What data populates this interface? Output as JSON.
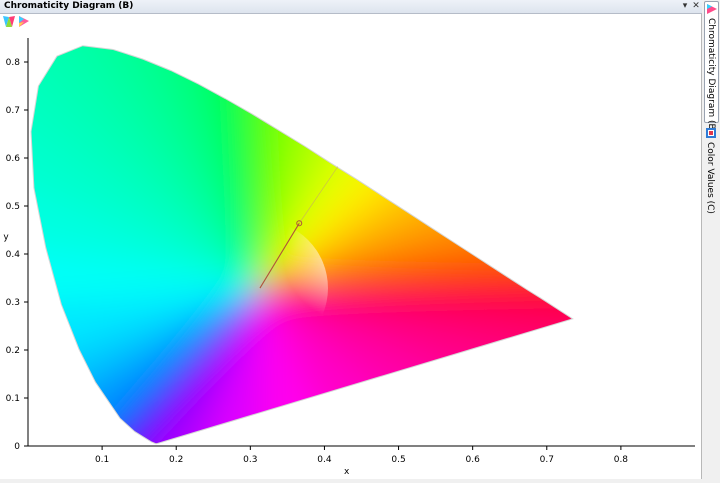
{
  "panel": {
    "title": "Chromaticity Diagram (B)"
  },
  "window_buttons": {
    "dropdown": "▾",
    "close": "✕"
  },
  "side_tabs": [
    {
      "label": "Chromaticity Diagram (B)",
      "icon": "chromaticity-icon",
      "active": true
    },
    {
      "label": "Color Values (C)",
      "icon": "color-values-icon",
      "active": false
    }
  ],
  "toolbar": {
    "icons": [
      "chromaticity-view-icon",
      "gamut-view-icon"
    ]
  },
  "chart_data": {
    "type": "scatter",
    "xlabel": "x",
    "ylabel": "y",
    "xlim": [
      0,
      0.9
    ],
    "ylim": [
      0,
      0.85
    ],
    "x_ticks": [
      "0.1",
      "0.2",
      "0.3",
      "0.4",
      "0.5",
      "0.6",
      "0.7",
      "0.8"
    ],
    "y_ticks": [
      "0",
      "0.1",
      "0.2",
      "0.3",
      "0.4",
      "0.5",
      "0.6",
      "0.7",
      "0.8"
    ],
    "spectral_locus": [
      [
        0.174,
        0.005
      ],
      [
        0.172,
        0.005
      ],
      [
        0.166,
        0.009
      ],
      [
        0.144,
        0.03
      ],
      [
        0.124,
        0.058
      ],
      [
        0.091,
        0.133
      ],
      [
        0.069,
        0.201
      ],
      [
        0.045,
        0.295
      ],
      [
        0.024,
        0.413
      ],
      [
        0.008,
        0.538
      ],
      [
        0.004,
        0.655
      ],
      [
        0.014,
        0.75
      ],
      [
        0.039,
        0.812
      ],
      [
        0.074,
        0.834
      ],
      [
        0.115,
        0.826
      ],
      [
        0.155,
        0.806
      ],
      [
        0.193,
        0.782
      ],
      [
        0.23,
        0.754
      ],
      [
        0.266,
        0.724
      ],
      [
        0.302,
        0.692
      ],
      [
        0.337,
        0.659
      ],
      [
        0.373,
        0.625
      ],
      [
        0.408,
        0.59
      ],
      [
        0.444,
        0.555
      ],
      [
        0.479,
        0.52
      ],
      [
        0.513,
        0.486
      ],
      [
        0.546,
        0.453
      ],
      [
        0.575,
        0.424
      ],
      [
        0.6,
        0.399
      ],
      [
        0.621,
        0.378
      ],
      [
        0.638,
        0.361
      ],
      [
        0.652,
        0.347
      ],
      [
        0.663,
        0.336
      ],
      [
        0.673,
        0.326
      ],
      [
        0.692,
        0.308
      ],
      [
        0.735,
        0.265
      ]
    ],
    "white_point": [
      0.313,
      0.329
    ],
    "measurement": {
      "point": [
        0.366,
        0.464
      ],
      "line_from": [
        0.313,
        0.329
      ]
    },
    "dominant_line_end": [
      0.418,
      0.582
    ],
    "colors": {
      "locus_edge": "#d6d6d6",
      "line": "#b0543a",
      "marker": "#b0543a"
    }
  }
}
